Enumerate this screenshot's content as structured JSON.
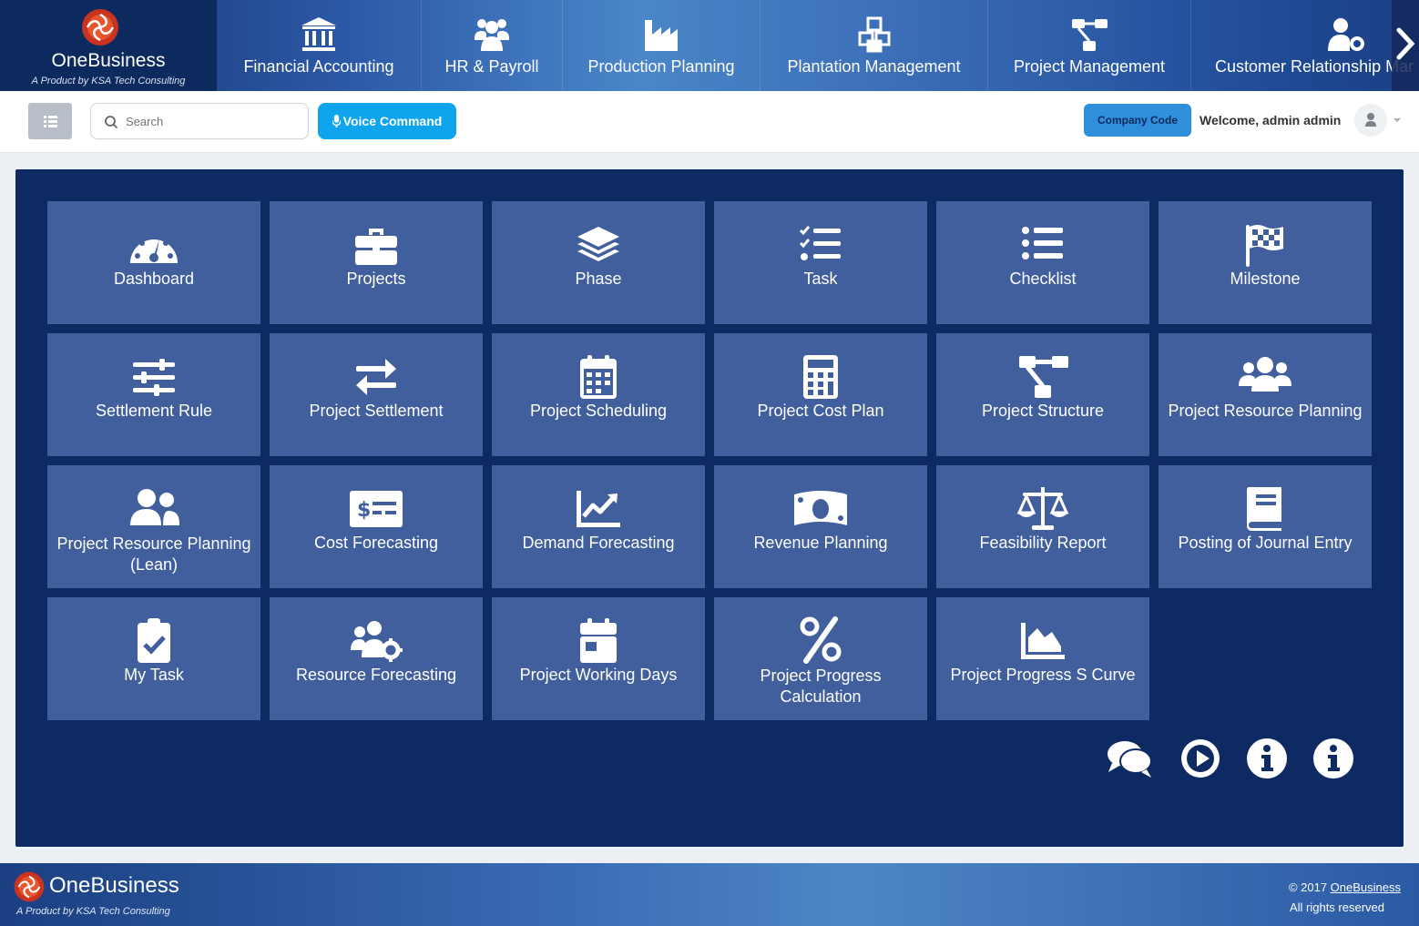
{
  "brand": {
    "name": "OneBusiness",
    "tagline": "A Product by KSA Tech Consulting"
  },
  "modules": [
    {
      "label": "Financial Accounting",
      "icon": "bank-icon"
    },
    {
      "label": "HR & Payroll",
      "icon": "users-icon"
    },
    {
      "label": "Production Planning",
      "icon": "industry-icon"
    },
    {
      "label": "Plantation Management",
      "icon": "cubes-icon"
    },
    {
      "label": "Project Management",
      "icon": "sitemap-icon"
    },
    {
      "label": "Customer Relationship Mar",
      "icon": "user-gear-icon"
    }
  ],
  "toolbar": {
    "search_placeholder": "Search",
    "voice_label": "Voice Command",
    "company_label": "Company Code",
    "welcome": "Welcome, admin admin"
  },
  "tiles": [
    {
      "label": "Dashboard",
      "icon": "gauge-icon"
    },
    {
      "label": "Projects",
      "icon": "briefcase-icon"
    },
    {
      "label": "Phase",
      "icon": "layers-icon"
    },
    {
      "label": "Task",
      "icon": "list-check-icon"
    },
    {
      "label": "Checklist",
      "icon": "list-icon"
    },
    {
      "label": "Milestone",
      "icon": "flag-checkered-icon"
    },
    {
      "label": "Settlement Rule",
      "icon": "sliders-icon"
    },
    {
      "label": "Project Settlement",
      "icon": "arrows-exchange-icon"
    },
    {
      "label": "Project Scheduling",
      "icon": "calendar-grid-icon"
    },
    {
      "label": "Project Cost Plan",
      "icon": "calculator-icon"
    },
    {
      "label": "Project Structure",
      "icon": "sitemap-icon"
    },
    {
      "label": "Project Resource Planning",
      "icon": "users-group-icon"
    },
    {
      "label": "Project Resource Planning (Lean)",
      "icon": "user-friends-icon"
    },
    {
      "label": "Cost Forecasting",
      "icon": "money-check-icon"
    },
    {
      "label": "Demand Forecasting",
      "icon": "chart-line-icon"
    },
    {
      "label": "Revenue Planning",
      "icon": "money-bill-icon"
    },
    {
      "label": "Feasibility Report",
      "icon": "balance-scale-icon"
    },
    {
      "label": "Posting of Journal Entry",
      "icon": "book-icon"
    },
    {
      "label": "My Task",
      "icon": "clipboard-check-icon"
    },
    {
      "label": "Resource Forecasting",
      "icon": "users-cog-icon"
    },
    {
      "label": "Project Working Days",
      "icon": "calendar-day-icon"
    },
    {
      "label": "Project Progress Calculation",
      "icon": "percent-icon"
    },
    {
      "label": "Project Progress S Curve",
      "icon": "chart-area-icon"
    }
  ],
  "help_icons": [
    "chat-icon",
    "play-circle-icon",
    "info-icon",
    "info-icon"
  ],
  "footer": {
    "name": "OneBusiness",
    "tagline": "A Product by KSA Tech Consulting",
    "copyright_prefix": "© 2017 ",
    "copyright_link": "OneBusiness",
    "rights": "All rights reserved"
  },
  "colors": {
    "brand_dark": "#0d2a5e",
    "panel": "#0e2a63",
    "tile": "#415e9d",
    "voice_button": "#0fa5ec",
    "company_button": "#2f8fdd"
  }
}
